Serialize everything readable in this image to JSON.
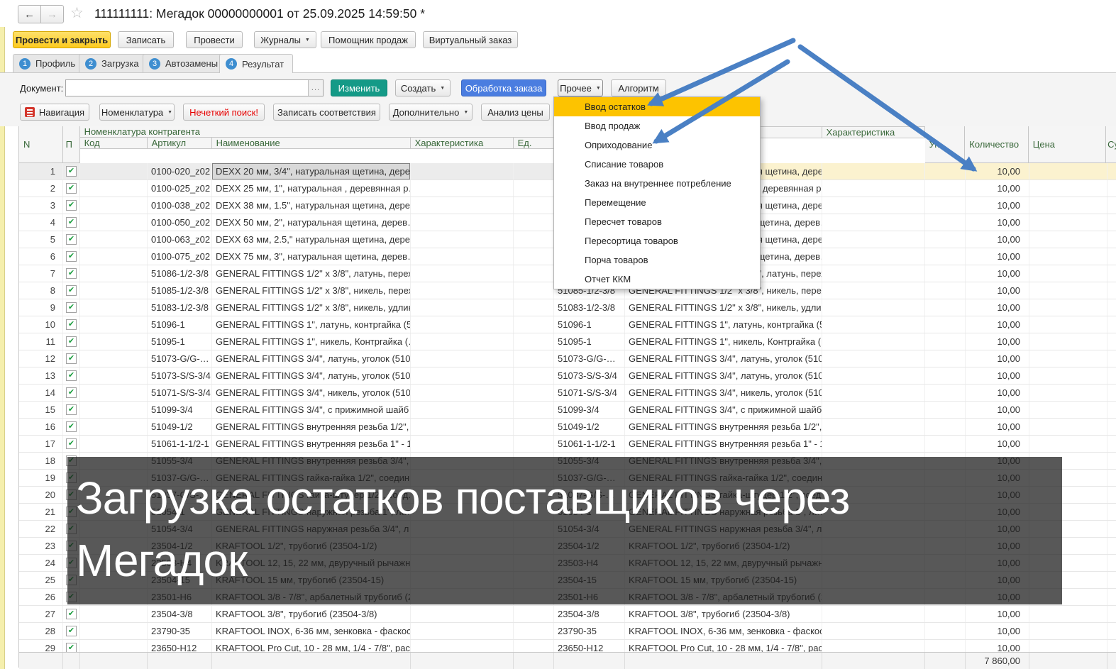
{
  "window": {
    "back_icon": "←",
    "forward_icon": "→",
    "star_icon": "☆",
    "title": "111111111: Мегадок 00000000001 от 25.09.2025 14:59:50 *"
  },
  "toolbar": {
    "buttons": [
      {
        "label": "Провести и закрыть"
      },
      {
        "label": "Записать"
      },
      {
        "label": "Провести"
      },
      {
        "label": "Журналы",
        "dropdown": true
      },
      {
        "label": "Помощник продаж"
      },
      {
        "label": "Виртуальный заказ"
      }
    ]
  },
  "tabs": [
    {
      "num": "1",
      "label": "Профиль"
    },
    {
      "num": "2",
      "label": "Загрузка"
    },
    {
      "num": "3",
      "label": "Автозамены"
    },
    {
      "num": "4",
      "label": "Результат"
    }
  ],
  "doc_bar": {
    "label": "Документ:",
    "input_value": "",
    "ellipsis": "...",
    "edit": "Изменить",
    "create": "Создать",
    "order_processing": "Обработка заказа",
    "other": "Прочее",
    "algorithm": "Алгоритм"
  },
  "actions_bar": {
    "navigation": "Навигация",
    "nomenclature": "Номенклатура",
    "fuzzy_search": "Нечеткий поиск!",
    "save_matches": "Записать соответствия",
    "additional": "Дополнительно",
    "price_analysis": "Анализ цены"
  },
  "menu": {
    "highlighted": "Ввод остатков",
    "items": [
      "Ввод остатков",
      "Ввод продаж",
      "Оприходование",
      "Списание товаров",
      "Заказ на внутреннее потребление",
      "Перемещение",
      "Пересчет товаров",
      "Пересортица товаров",
      "Порча товаров",
      "Отчет ККМ"
    ]
  },
  "table": {
    "headers": {
      "n": "N",
      "p": "П",
      "group_left": "Номенклатура контрагента",
      "code": "Код",
      "articul": "Артикул",
      "name": "Наименование",
      "characteristic": "Характеристика",
      "unit": "Ед.",
      "characteristic2": "Характеристика",
      "pack": "Уп.",
      "quantity": "Количество",
      "price": "Цена",
      "sum": "Су"
    },
    "rows": [
      {
        "n": "1",
        "checked": true,
        "articul": "0100-020_z02",
        "name": "DEXX 20 мм, 3/4\", натуральная щетина, дере…",
        "qty": "10,00"
      },
      {
        "n": "2",
        "checked": true,
        "articul": "0100-025_z02",
        "name": "DEXX 25 мм, 1\", натуральная , деревянная р…",
        "qty": "10,00"
      },
      {
        "n": "3",
        "checked": true,
        "articul": "0100-038_z02",
        "name": "DEXX 38 мм, 1.5\", натуральная щетина, дере…",
        "qty": "10,00"
      },
      {
        "n": "4",
        "checked": true,
        "articul": "0100-050_z02",
        "name": "DEXX 50 мм, 2\", натуральная щетина, дерев…",
        "qty": "10,00"
      },
      {
        "n": "5",
        "checked": true,
        "articul": "0100-063_z02",
        "name": "DEXX 63 мм, 2.5,\" натуральная щетина, дере…",
        "qty": "10,00"
      },
      {
        "n": "6",
        "checked": true,
        "articul": "0100-075_z02",
        "name": "DEXX 75 мм, 3\", натуральная щетина, дерев…",
        "qty": "10,00"
      },
      {
        "n": "7",
        "checked": true,
        "articul": "51086-1/2-3/8",
        "name": "GENERAL FITTINGS 1/2\" x 3/8\", латунь, перех…",
        "qty": "10,00"
      },
      {
        "n": "8",
        "checked": true,
        "articul": "51085-1/2-3/8",
        "name": "GENERAL FITTINGS 1/2\" x 3/8\", никель, перех…",
        "qty": "10,00"
      },
      {
        "n": "9",
        "checked": true,
        "articul": "51083-1/2-3/8",
        "name": "GENERAL FITTINGS 1/2\" x 3/8\", никель, удлин…",
        "qty": "10,00"
      },
      {
        "n": "10",
        "checked": true,
        "articul": "51096-1",
        "name": "GENERAL FITTINGS 1\", латунь, контргайка (5…",
        "qty": "10,00"
      },
      {
        "n": "11",
        "checked": true,
        "articul": "51095-1",
        "name": "GENERAL FITTINGS 1\", никель, Контргайка (…",
        "qty": "10,00"
      },
      {
        "n": "12",
        "checked": true,
        "articul": "51073-G/G-…",
        "name": "GENERAL FITTINGS 3/4\", латунь, уголок (510…",
        "qty": "10,00"
      },
      {
        "n": "13",
        "checked": true,
        "articul": "51073-S/S-3/4",
        "name": "GENERAL FITTINGS 3/4\", латунь, уголок (510…",
        "qty": "10,00"
      },
      {
        "n": "14",
        "checked": true,
        "articul": "51071-S/S-3/4",
        "name": "GENERAL FITTINGS 3/4\", никель, уголок (510…",
        "qty": "10,00"
      },
      {
        "n": "15",
        "checked": true,
        "articul": "51099-3/4",
        "name": "GENERAL FITTINGS 3/4\", с прижимной шайб…",
        "qty": "10,00"
      },
      {
        "n": "16",
        "checked": true,
        "articul": "51049-1/2",
        "name": "GENERAL FITTINGS внутренняя резьба 1/2\", …",
        "qty": "10,00"
      },
      {
        "n": "17",
        "checked": true,
        "articul": "51061-1-1/2-1",
        "name": "GENERAL FITTINGS внутренняя резьба 1\" - 1…",
        "qty": "10,00"
      },
      {
        "n": "18",
        "checked": true,
        "articul": "51055-3/4",
        "name": "GENERAL FITTINGS внутренняя резьба 3/4\", …",
        "qty": "10,00"
      },
      {
        "n": "19",
        "checked": true,
        "articul": "51037-G/G-…",
        "name": "GENERAL FITTINGS гайка-гайка 1/2\", соедин…",
        "qty": "10,00"
      },
      {
        "n": "20",
        "checked": true,
        "articul": "51037-G/S-…",
        "name": "GENERAL FITTINGS гайка-штуцер 1/2\", соед…",
        "qty": "10,00"
      },
      {
        "n": "21",
        "checked": true,
        "articul": "51054-1",
        "name": "GENERAL FITTINGS наружная резьба 1\", лат…",
        "qty": "10,00"
      },
      {
        "n": "22",
        "checked": true,
        "articul": "51054-3/4",
        "name": "GENERAL FITTINGS наружная резьба 3/4\", л…",
        "qty": "10,00"
      },
      {
        "n": "23",
        "checked": true,
        "articul": "23504-1/2",
        "name": "KRAFTOOL 1/2\", трубогиб (23504-1/2)",
        "qty": "10,00"
      },
      {
        "n": "24",
        "checked": true,
        "articul": "23503-H4",
        "name": "KRAFTOOL 12, 15, 22 мм, двуручный рычажн…",
        "qty": "10,00"
      },
      {
        "n": "25",
        "checked": true,
        "articul": "23504-15",
        "name": "KRAFTOOL 15 мм, трубогиб (23504-15)",
        "qty": "10,00"
      },
      {
        "n": "26",
        "checked": true,
        "articul": "23501-H6",
        "name": "KRAFTOOL 3/8 - 7/8\", арбалетный трубогиб (2…",
        "qty": "10,00"
      },
      {
        "n": "27",
        "checked": true,
        "articul": "23504-3/8",
        "name": "KRAFTOOL 3/8\", трубогиб (23504-3/8)",
        "qty": "10,00"
      },
      {
        "n": "28",
        "checked": true,
        "articul": "23790-35",
        "name": "KRAFTOOL INOX, 6-36 мм, зенковка - фаскос…",
        "qty": "10,00"
      },
      {
        "n": "29",
        "checked": true,
        "articul": "23650-H12",
        "name": "KRAFTOOL Pro Cut, 10 - 28 мм, 1/4 - 7/8\", рас…",
        "qty": "10,00"
      }
    ],
    "footer": {
      "total_quantity": "7 860,00"
    }
  },
  "overlay": {
    "line1": "Загрузка остатков поставщиков через",
    "line2": "Мегадок"
  },
  "icons": {
    "check": "✔",
    "dropdown_arrow": "▼"
  },
  "colors": {
    "accent_yellow": "#FDC300",
    "teal_button": "#149A87",
    "blue_button": "#4A7DE0",
    "tab_circle_blue": "#3E8ED0",
    "arrow_blue": "#4A80C4",
    "selected_row": "#FBF2CF",
    "danger_red": "#E60000",
    "check_green": "#189C3C",
    "header_text_green": "#39683A"
  }
}
